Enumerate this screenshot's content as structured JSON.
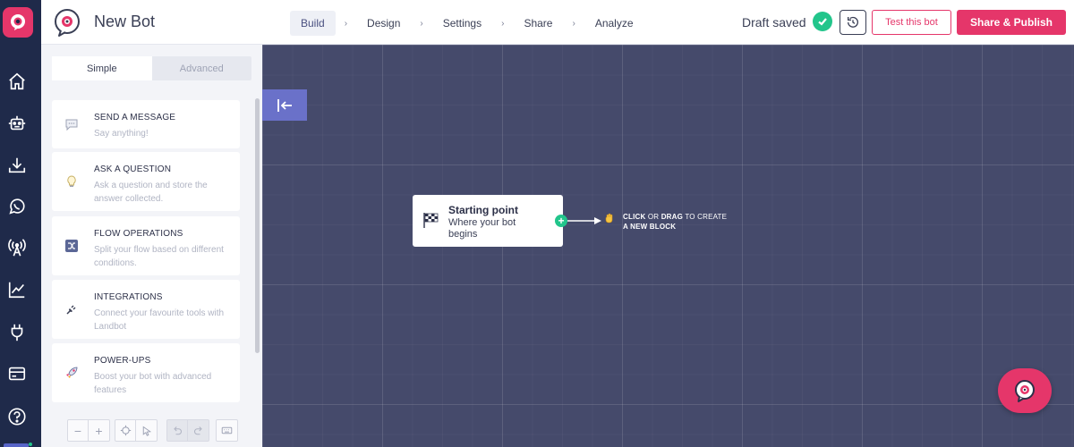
{
  "header": {
    "bot_name": "New Bot",
    "nav": [
      "Build",
      "Design",
      "Settings",
      "Share",
      "Analyze"
    ],
    "nav_separator": "›",
    "active_tab": "Build",
    "status": "Draft saved",
    "test_label": "Test this bot",
    "publish_label": "Share & Publish"
  },
  "panel": {
    "tabs": [
      "Simple",
      "Advanced"
    ],
    "active_tab": "Simple",
    "blocks": [
      {
        "title": "SEND A MESSAGE",
        "desc": "Say anything!",
        "icon": "speech-bubble-icon"
      },
      {
        "title": "ASK A QUESTION",
        "desc": "Ask a question and store the answer collected.",
        "icon": "lightbulb-icon"
      },
      {
        "title": "FLOW OPERATIONS",
        "desc": "Split your flow based on different conditions.",
        "icon": "shuffle-icon"
      },
      {
        "title": "INTEGRATIONS",
        "desc": "Connect your favourite tools with Landbot",
        "icon": "plug-icon"
      },
      {
        "title": "POWER-UPS",
        "desc": "Boost your bot with advanced features",
        "icon": "rocket-icon"
      }
    ],
    "toolbar": {
      "zoom_out": "−",
      "zoom_in": "+"
    }
  },
  "canvas": {
    "start_title": "Starting point",
    "start_desc": "Where your bot begins",
    "hint_click": "CLICK",
    "hint_or": " OR ",
    "hint_drag": "DRAG",
    "hint_rest": " TO CREATE",
    "hint_line2": "A NEW BLOCK"
  },
  "colors": {
    "brand": "#e5366a",
    "rail": "#1f2a4a",
    "canvas": "#454a6b",
    "success": "#22c58b",
    "accent": "#6a71c9"
  }
}
